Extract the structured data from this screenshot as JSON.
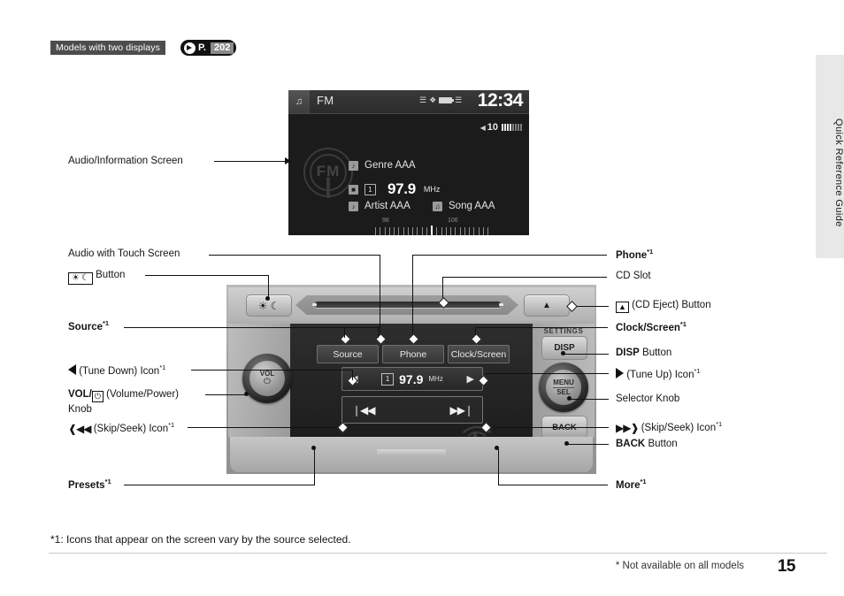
{
  "header": {
    "models_badge": "Models with two displays",
    "ref_prefix": "P.",
    "ref_page": "202"
  },
  "side_tab": {
    "label": "Quick Reference Guide"
  },
  "screen": {
    "tab_icon": "music-note-icon",
    "source": "FM",
    "clock": "12:34",
    "status_icons": [
      "bluetooth-icon",
      "battery-icon",
      "signal-icon"
    ],
    "volume_label": "10",
    "volume_level": 4,
    "volume_segments": 8,
    "logo_text": "FM",
    "genre": "Genre AAA",
    "preset_number": "1",
    "frequency": "97.9",
    "frequency_unit": "MHz",
    "artist": "Artist AAA",
    "song": "Song AAA",
    "scale_low": "98",
    "scale_high": "106",
    "scale_ticks": 25,
    "scale_current_index": 12
  },
  "unit": {
    "settings_label": "SETTINGS",
    "disp_button": "DISP",
    "back_button": "BACK",
    "selector_line1": "MENU",
    "selector_line2": "SEL",
    "vol_line1": "VOL",
    "vol_power_glyph": "⏻",
    "eject_glyph": "▲",
    "sun_glyph": "☀",
    "moon_glyph": "☾",
    "touch_buttons": [
      "Source",
      "Phone",
      "Clock/Screen"
    ],
    "freq_left_arrow": "◀",
    "freq_right_arrow": "▶",
    "freq_preset": "1",
    "freq_value": "97.9",
    "freq_unit": "MHz",
    "seek_prev": "❘◀◀",
    "seek_next": "▶▶❘",
    "presets_label": "Presets",
    "more_label": "More..."
  },
  "callouts": {
    "audio_info_screen": "Audio/Information Screen",
    "audio_touch_screen": "Audio with Touch Screen",
    "sunmoon_button": "Button",
    "source": "Source",
    "tune_down": "(Tune Down) Icon",
    "volume_power": "(Volume/Power)",
    "volume_power_knob2": "Knob",
    "volume_power_prefix": "VOL/",
    "skip_seek_prev": "(Skip/Seek) Icon",
    "presets": "Presets",
    "phone": "Phone",
    "cd_slot": "CD Slot",
    "cd_eject": "(CD Eject) Button",
    "clock_screen": "Clock/Screen",
    "disp_button": "DISP",
    "disp_button_suffix": "Button",
    "tune_up": "(Tune Up) Icon",
    "selector_knob": "Selector Knob",
    "skip_seek_next": "(Skip/Seek) Icon",
    "back_button": "BACK",
    "back_button_suffix": "Button",
    "more": "More",
    "sup_mark": "*1"
  },
  "footer": {
    "footnote": "*1: Icons that appear on the screen vary by the source selected.",
    "not_available": "* Not available on all models",
    "page_number": "15"
  }
}
